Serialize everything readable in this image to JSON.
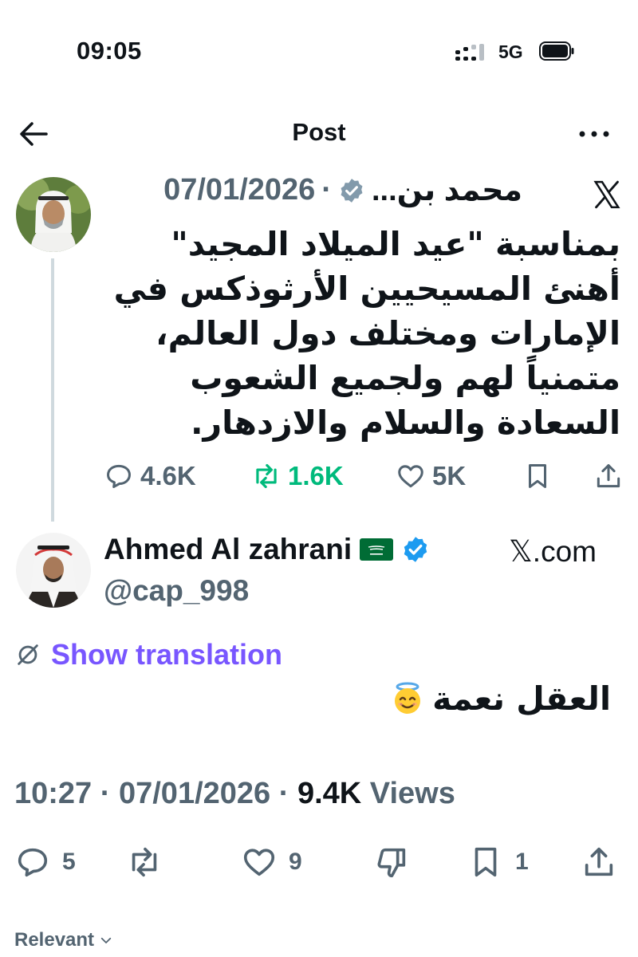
{
  "status_bar": {
    "time": "09:05",
    "network": "5G"
  },
  "nav": {
    "title": "Post"
  },
  "quoted_post": {
    "author_name": "محمد بن...",
    "separator": "·",
    "date": "07/01/2026",
    "text_lines": [
      "بمناسبة \"عيد الميلاد المجيد\"",
      "أهنئ المسيحيين الأرثوذكس في",
      "الإمارات ومختلف دول العالم،",
      "متمنياً لهم ولجميع الشعوب",
      "السعادة والسلام والازدهار."
    ],
    "replies": "4.6K",
    "reposts": "1.6K",
    "likes": "5K"
  },
  "reply_post": {
    "author_name": "Ahmed Al zahrani",
    "handle": "@cap_998",
    "source": "𝕏.com",
    "show_translation": "Show translation",
    "text": "العقل نعمة",
    "time": "10:27",
    "separator": "·",
    "date": "07/01/2026",
    "views_count": "9.4K",
    "views_label": "Views",
    "replies": "5",
    "likes": "9",
    "bookmarks": "1"
  },
  "filter": {
    "label": "Relevant"
  },
  "colors": {
    "verified_blue": "#1d9bf0",
    "repost_green": "#00ba7c",
    "translate_purple": "#7856ff",
    "muted": "#536471"
  }
}
